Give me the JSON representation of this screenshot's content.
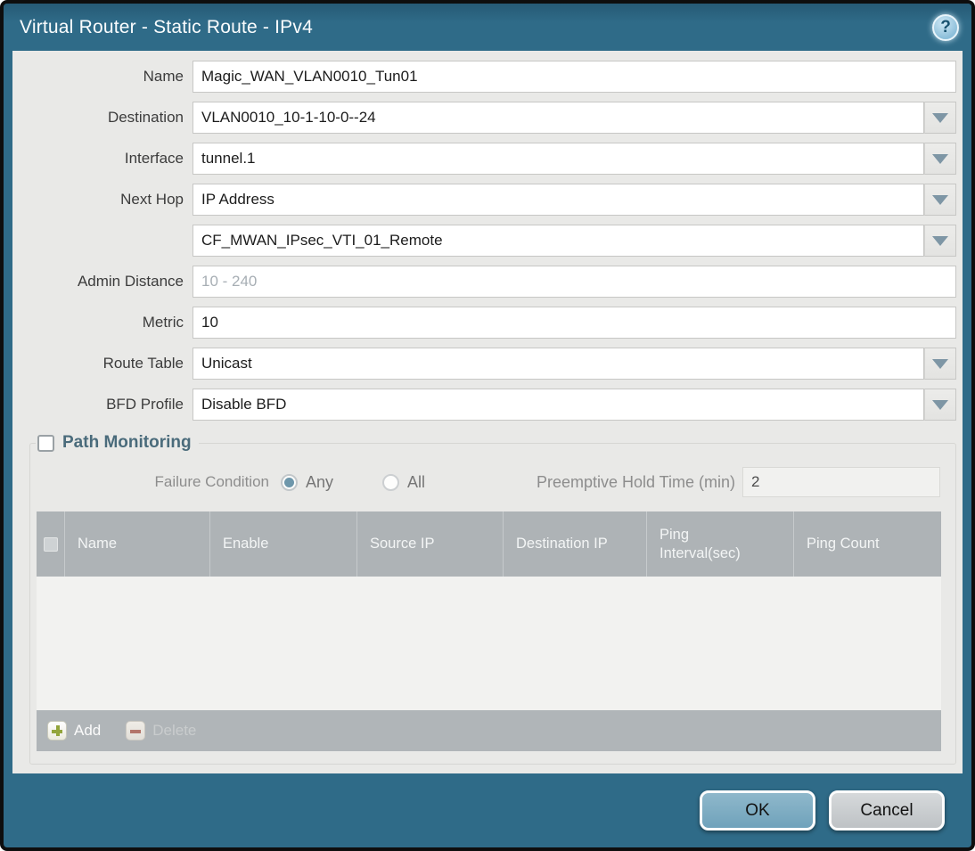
{
  "window": {
    "title": "Virtual Router - Static Route - IPv4",
    "help_glyph": "?"
  },
  "form": {
    "fields": [
      {
        "label": "Name",
        "value": "Magic_WAN_VLAN0010_Tun01",
        "type": "text"
      },
      {
        "label": "Destination",
        "value": "VLAN0010_10-1-10-0--24",
        "type": "dropdown"
      },
      {
        "label": "Interface",
        "value": "tunnel.1",
        "type": "dropdown"
      },
      {
        "label": "Next Hop",
        "value": "IP Address",
        "type": "dropdown"
      },
      {
        "label": "",
        "value": "CF_MWAN_IPsec_VTI_01_Remote",
        "type": "dropdown"
      },
      {
        "label": "Admin Distance",
        "value": "",
        "placeholder": "10 - 240",
        "type": "text"
      },
      {
        "label": "Metric",
        "value": "10",
        "type": "text"
      },
      {
        "label": "Route Table",
        "value": "Unicast",
        "type": "dropdown"
      },
      {
        "label": "BFD Profile",
        "value": "Disable BFD",
        "type": "dropdown"
      }
    ]
  },
  "path_monitoring": {
    "title": "Path Monitoring",
    "enabled": false,
    "failure_condition_label": "Failure Condition",
    "option_any": "Any",
    "option_all": "All",
    "selected_option": "Any",
    "hold_time_label": "Preemptive Hold Time (min)",
    "hold_time_value": "2",
    "table": {
      "columns": [
        "Name",
        "Enable",
        "Source IP",
        "Destination IP",
        "Ping Interval(sec)",
        "Ping Count"
      ],
      "rows": [],
      "add_label": "Add",
      "delete_label": "Delete"
    }
  },
  "footer": {
    "ok_label": "OK",
    "cancel_label": "Cancel"
  },
  "colors": {
    "titlebar_teal": "#2f6b88",
    "content_bg": "#e9e9e7",
    "table_header_bg": "#aeb3b6",
    "table_footer_bg": "#b0b5b8",
    "ok_button": "#7aa9c0",
    "cancel_button": "#c6cacc",
    "add_icon_green": "#93a53b",
    "delete_icon_red": "#b3756a",
    "radio_selected": "#6e97ab"
  }
}
